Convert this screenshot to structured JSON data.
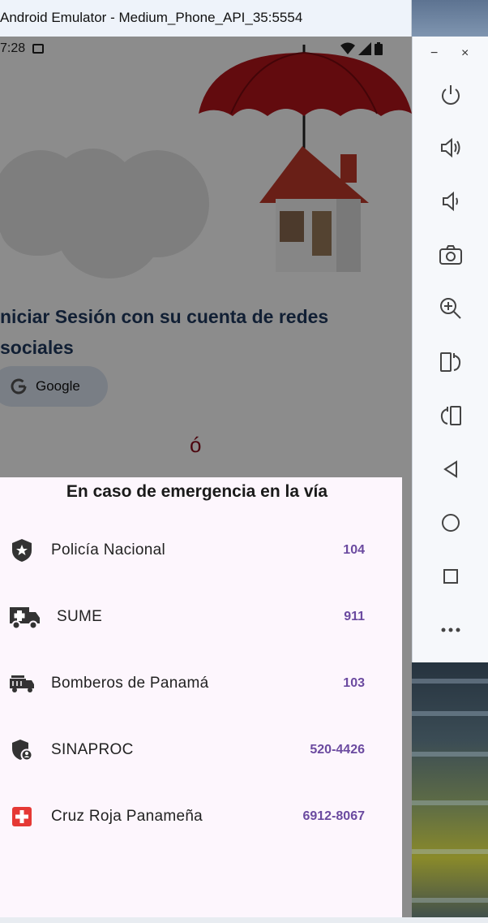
{
  "window": {
    "title": "Android Emulator - Medium_Phone_API_35:5554"
  },
  "emulator_toolbar": {
    "minimize_label": "−",
    "close_label": "×",
    "buttons": [
      "power-icon",
      "volume-up-icon",
      "volume-down-icon",
      "camera-icon",
      "zoom-icon",
      "rotate-left-icon",
      "rotate-right-icon",
      "back-icon",
      "home-icon",
      "overview-icon",
      "more-icon"
    ]
  },
  "status_bar": {
    "time": "7:28"
  },
  "login": {
    "headline": "niciar Sesión con su cuenta de redes sociales",
    "google_label": "Google",
    "or_text": "ó"
  },
  "emergency_sheet": {
    "title": "En caso de emergencia en la vía",
    "contacts": [
      {
        "name": "Policía Nacional",
        "number": "104",
        "icon": "police-shield-icon"
      },
      {
        "name": "SUME",
        "number": "911",
        "icon": "ambulance-icon"
      },
      {
        "name": "Bomberos de Panamá",
        "number": "103",
        "icon": "fire-truck-icon"
      },
      {
        "name": "SINAPROC",
        "number": "520-4426",
        "icon": "civil-protection-shield-icon"
      },
      {
        "name": "Cruz Roja Panameña",
        "number": "6912-8067",
        "icon": "red-cross-icon"
      }
    ]
  },
  "colors": {
    "accent_number": "#6b4aa0",
    "headline": "#1f3a5f",
    "red_cross": "#e53935",
    "umbrella": "#b3141b"
  }
}
